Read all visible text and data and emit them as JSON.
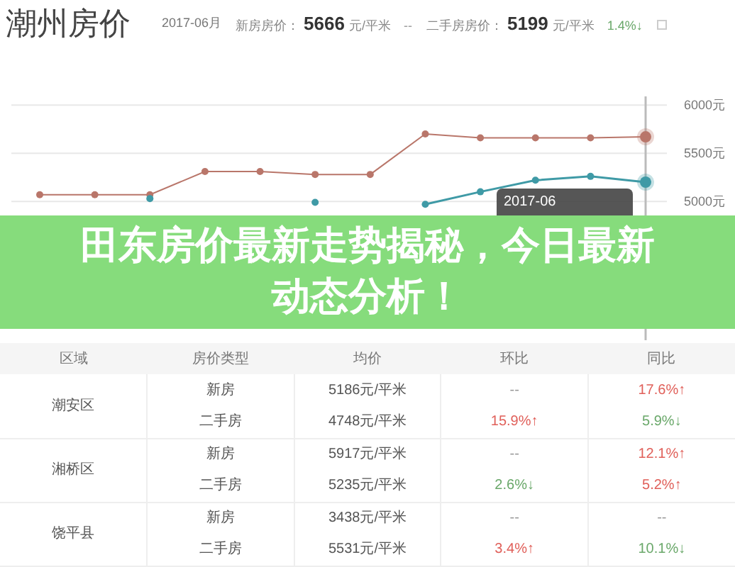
{
  "header": {
    "title": "潮州房价",
    "month": "2017-06月",
    "new_label": "新房房价：",
    "new_price": "5666",
    "new_unit": "元/平米",
    "new_change": "--",
    "used_label": "二手房房价：",
    "used_price": "5199",
    "used_unit": "元/平米",
    "used_change": {
      "text": "1.4%↓",
      "color": "#6aa86a"
    }
  },
  "chart": {
    "tooltip_title": "2017-06",
    "chart_data": {
      "type": "line",
      "grid": true,
      "ylim": [
        3560,
        6090
      ],
      "yticks": [
        {
          "value": 5000,
          "label": "5000元"
        },
        {
          "value": 5500,
          "label": "5500元"
        },
        {
          "value": 6000,
          "label": "6000元"
        }
      ],
      "series": [
        {
          "color": "#b9766a",
          "marker": "circle",
          "values": [
            5070,
            5070,
            5070,
            5310,
            5310,
            5280,
            5280,
            5700,
            5660,
            5660,
            5660,
            5670
          ]
        },
        {
          "color": "#3f9aa6",
          "marker": "circle",
          "values": [
            null,
            null,
            5030,
            null,
            null,
            4990,
            null,
            4970,
            5100,
            5220,
            5260,
            5200
          ]
        }
      ]
    }
  },
  "banner": {
    "text": "田东房价最新走势揭秘，今日最新动态分析！"
  },
  "table": {
    "columns": [
      "区域",
      "房价类型",
      "均价",
      "环比",
      "同比"
    ],
    "rows": [
      {
        "region": "潮安区",
        "items": [
          {
            "type": "新房",
            "price": "5186元/平米",
            "mom": {
              "text": "--",
              "color": "#999999"
            },
            "yoy": {
              "text": "17.6%↑",
              "color": "#e0605a"
            }
          },
          {
            "type": "二手房",
            "price": "4748元/平米",
            "mom": {
              "text": "15.9%↑",
              "color": "#e0605a"
            },
            "yoy": {
              "text": "5.9%↓",
              "color": "#6aa86a"
            }
          }
        ]
      },
      {
        "region": "湘桥区",
        "items": [
          {
            "type": "新房",
            "price": "5917元/平米",
            "mom": {
              "text": "--",
              "color": "#999999"
            },
            "yoy": {
              "text": "12.1%↑",
              "color": "#e0605a"
            }
          },
          {
            "type": "二手房",
            "price": "5235元/平米",
            "mom": {
              "text": "2.6%↓",
              "color": "#6aa86a"
            },
            "yoy": {
              "text": "5.2%↑",
              "color": "#e0605a"
            }
          }
        ]
      },
      {
        "region": "饶平县",
        "items": [
          {
            "type": "新房",
            "price": "3438元/平米",
            "mom": {
              "text": "--",
              "color": "#999999"
            },
            "yoy": {
              "text": "--",
              "color": "#999999"
            }
          },
          {
            "type": "二手房",
            "price": "5531元/平米",
            "mom": {
              "text": "3.4%↑",
              "color": "#e0605a"
            },
            "yoy": {
              "text": "10.1%↓",
              "color": "#6aa86a"
            }
          }
        ]
      }
    ]
  }
}
